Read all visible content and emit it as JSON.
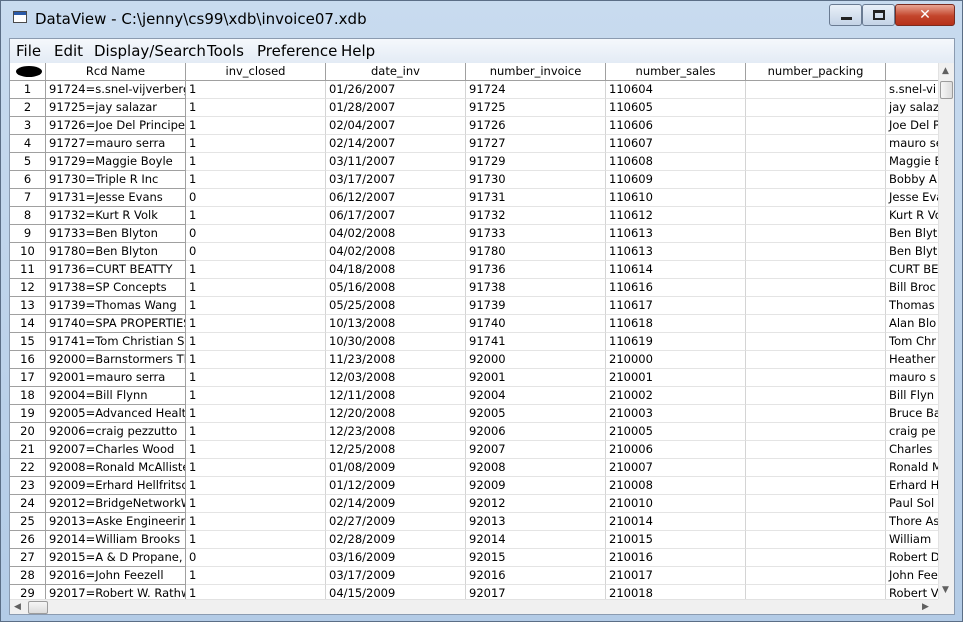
{
  "window": {
    "title": "DataView - C:\\jenny\\cs99\\xdb\\invoice07.xdb",
    "controls": {
      "minimize": "minimize",
      "maximize": "maximize",
      "close": "✕"
    }
  },
  "menu": [
    "File",
    "Edit",
    "Display/Search",
    "Tools",
    "Preference",
    "Help"
  ],
  "columns": [
    "Rcd Name",
    "inv_closed",
    "date_inv",
    "number_invoice",
    "number_sales",
    "number_packing",
    ""
  ],
  "rows": [
    [
      "1",
      "91724=s.snel-vijverberg",
      "1",
      "01/26/2007",
      "91724",
      "110604",
      "",
      "s.snel-vi"
    ],
    [
      "2",
      "91725=jay salazar",
      "1",
      "01/28/2007",
      "91725",
      "110605",
      "",
      "jay salaz"
    ],
    [
      "3",
      "91726=Joe Del Principe",
      "1",
      "02/04/2007",
      "91726",
      "110606",
      "",
      "Joe Del P"
    ],
    [
      "4",
      "91727=mauro serra",
      "1",
      "02/14/2007",
      "91727",
      "110607",
      "",
      "mauro se"
    ],
    [
      "5",
      "91729=Maggie Boyle",
      "1",
      "03/11/2007",
      "91729",
      "110608",
      "",
      "Maggie B"
    ],
    [
      "6",
      "91730=Triple R Inc",
      "1",
      "03/17/2007",
      "91730",
      "110609",
      "",
      "Bobby A"
    ],
    [
      "7",
      "91731=Jesse Evans",
      "0",
      "06/12/2007",
      "91731",
      "110610",
      "",
      "Jesse Eva"
    ],
    [
      "8",
      "91732=Kurt R Volk",
      "1",
      "06/17/2007",
      "91732",
      "110612",
      "",
      "Kurt R Vo"
    ],
    [
      "9",
      "91733=Ben Blyton",
      "0",
      "04/02/2008",
      "91733",
      "110613",
      "",
      "Ben Blyt"
    ],
    [
      "10",
      "91780=Ben Blyton",
      "0",
      "04/02/2008",
      "91780",
      "110613",
      "",
      "Ben Blyt"
    ],
    [
      "11",
      "91736=CURT BEATTY",
      "1",
      "04/18/2008",
      "91736",
      "110614",
      "",
      "CURT BE"
    ],
    [
      "12",
      "91738=SP Concepts",
      "1",
      "05/16/2008",
      "91738",
      "110616",
      "",
      "Bill Broc"
    ],
    [
      "13",
      "91739=Thomas Wang",
      "1",
      "05/25/2008",
      "91739",
      "110617",
      "",
      "Thomas"
    ],
    [
      "14",
      "91740=SPA PROPERTIES (",
      "1",
      "10/13/2008",
      "91740",
      "110618",
      "",
      "Alan Blo"
    ],
    [
      "15",
      "91741=Tom Christian Sve",
      "1",
      "10/30/2008",
      "91741",
      "110619",
      "",
      "Tom Chr"
    ],
    [
      "16",
      "92000=Barnstormers The",
      "1",
      "11/23/2008",
      "92000",
      "210000",
      "",
      "Heather"
    ],
    [
      "17",
      "92001=mauro serra",
      "1",
      "12/03/2008",
      "92001",
      "210001",
      "",
      "mauro s"
    ],
    [
      "18",
      "92004=Bill Flynn",
      "1",
      "12/11/2008",
      "92004",
      "210002",
      "",
      "Bill Flyn"
    ],
    [
      "19",
      "92005=Advanced Health",
      "1",
      "12/20/2008",
      "92005",
      "210003",
      "",
      "Bruce Ba"
    ],
    [
      "20",
      "92006=craig pezzutto",
      "1",
      "12/23/2008",
      "92006",
      "210005",
      "",
      "craig pe"
    ],
    [
      "21",
      "92007=Charles Wood",
      "1",
      "12/25/2008",
      "92007",
      "210006",
      "",
      "Charles"
    ],
    [
      "22",
      "92008=Ronald McAlliste",
      "1",
      "01/08/2009",
      "92008",
      "210007",
      "",
      "Ronald M"
    ],
    [
      "23",
      "92009=Erhard Hellfritscl",
      "1",
      "01/12/2009",
      "92009",
      "210008",
      "",
      "Erhard H"
    ],
    [
      "24",
      "92012=BridgeNetworkWe",
      "1",
      "02/14/2009",
      "92012",
      "210010",
      "",
      "Paul Sol"
    ],
    [
      "25",
      "92013=Aske Engineering",
      "1",
      "02/27/2009",
      "92013",
      "210014",
      "",
      "Thore As"
    ],
    [
      "26",
      "92014=William Brooks",
      "1",
      "02/28/2009",
      "92014",
      "210015",
      "",
      "William"
    ],
    [
      "27",
      "92015=A & D Propane, Ir",
      "0",
      "03/16/2009",
      "92015",
      "210016",
      "",
      "Robert D"
    ],
    [
      "28",
      "92016=John Feezell",
      "1",
      "03/17/2009",
      "92016",
      "210017",
      "",
      "John Fee"
    ],
    [
      "29",
      "92017=Robert W. Rathw",
      "1",
      "04/15/2009",
      "92017",
      "210018",
      "",
      "Robert V"
    ]
  ]
}
